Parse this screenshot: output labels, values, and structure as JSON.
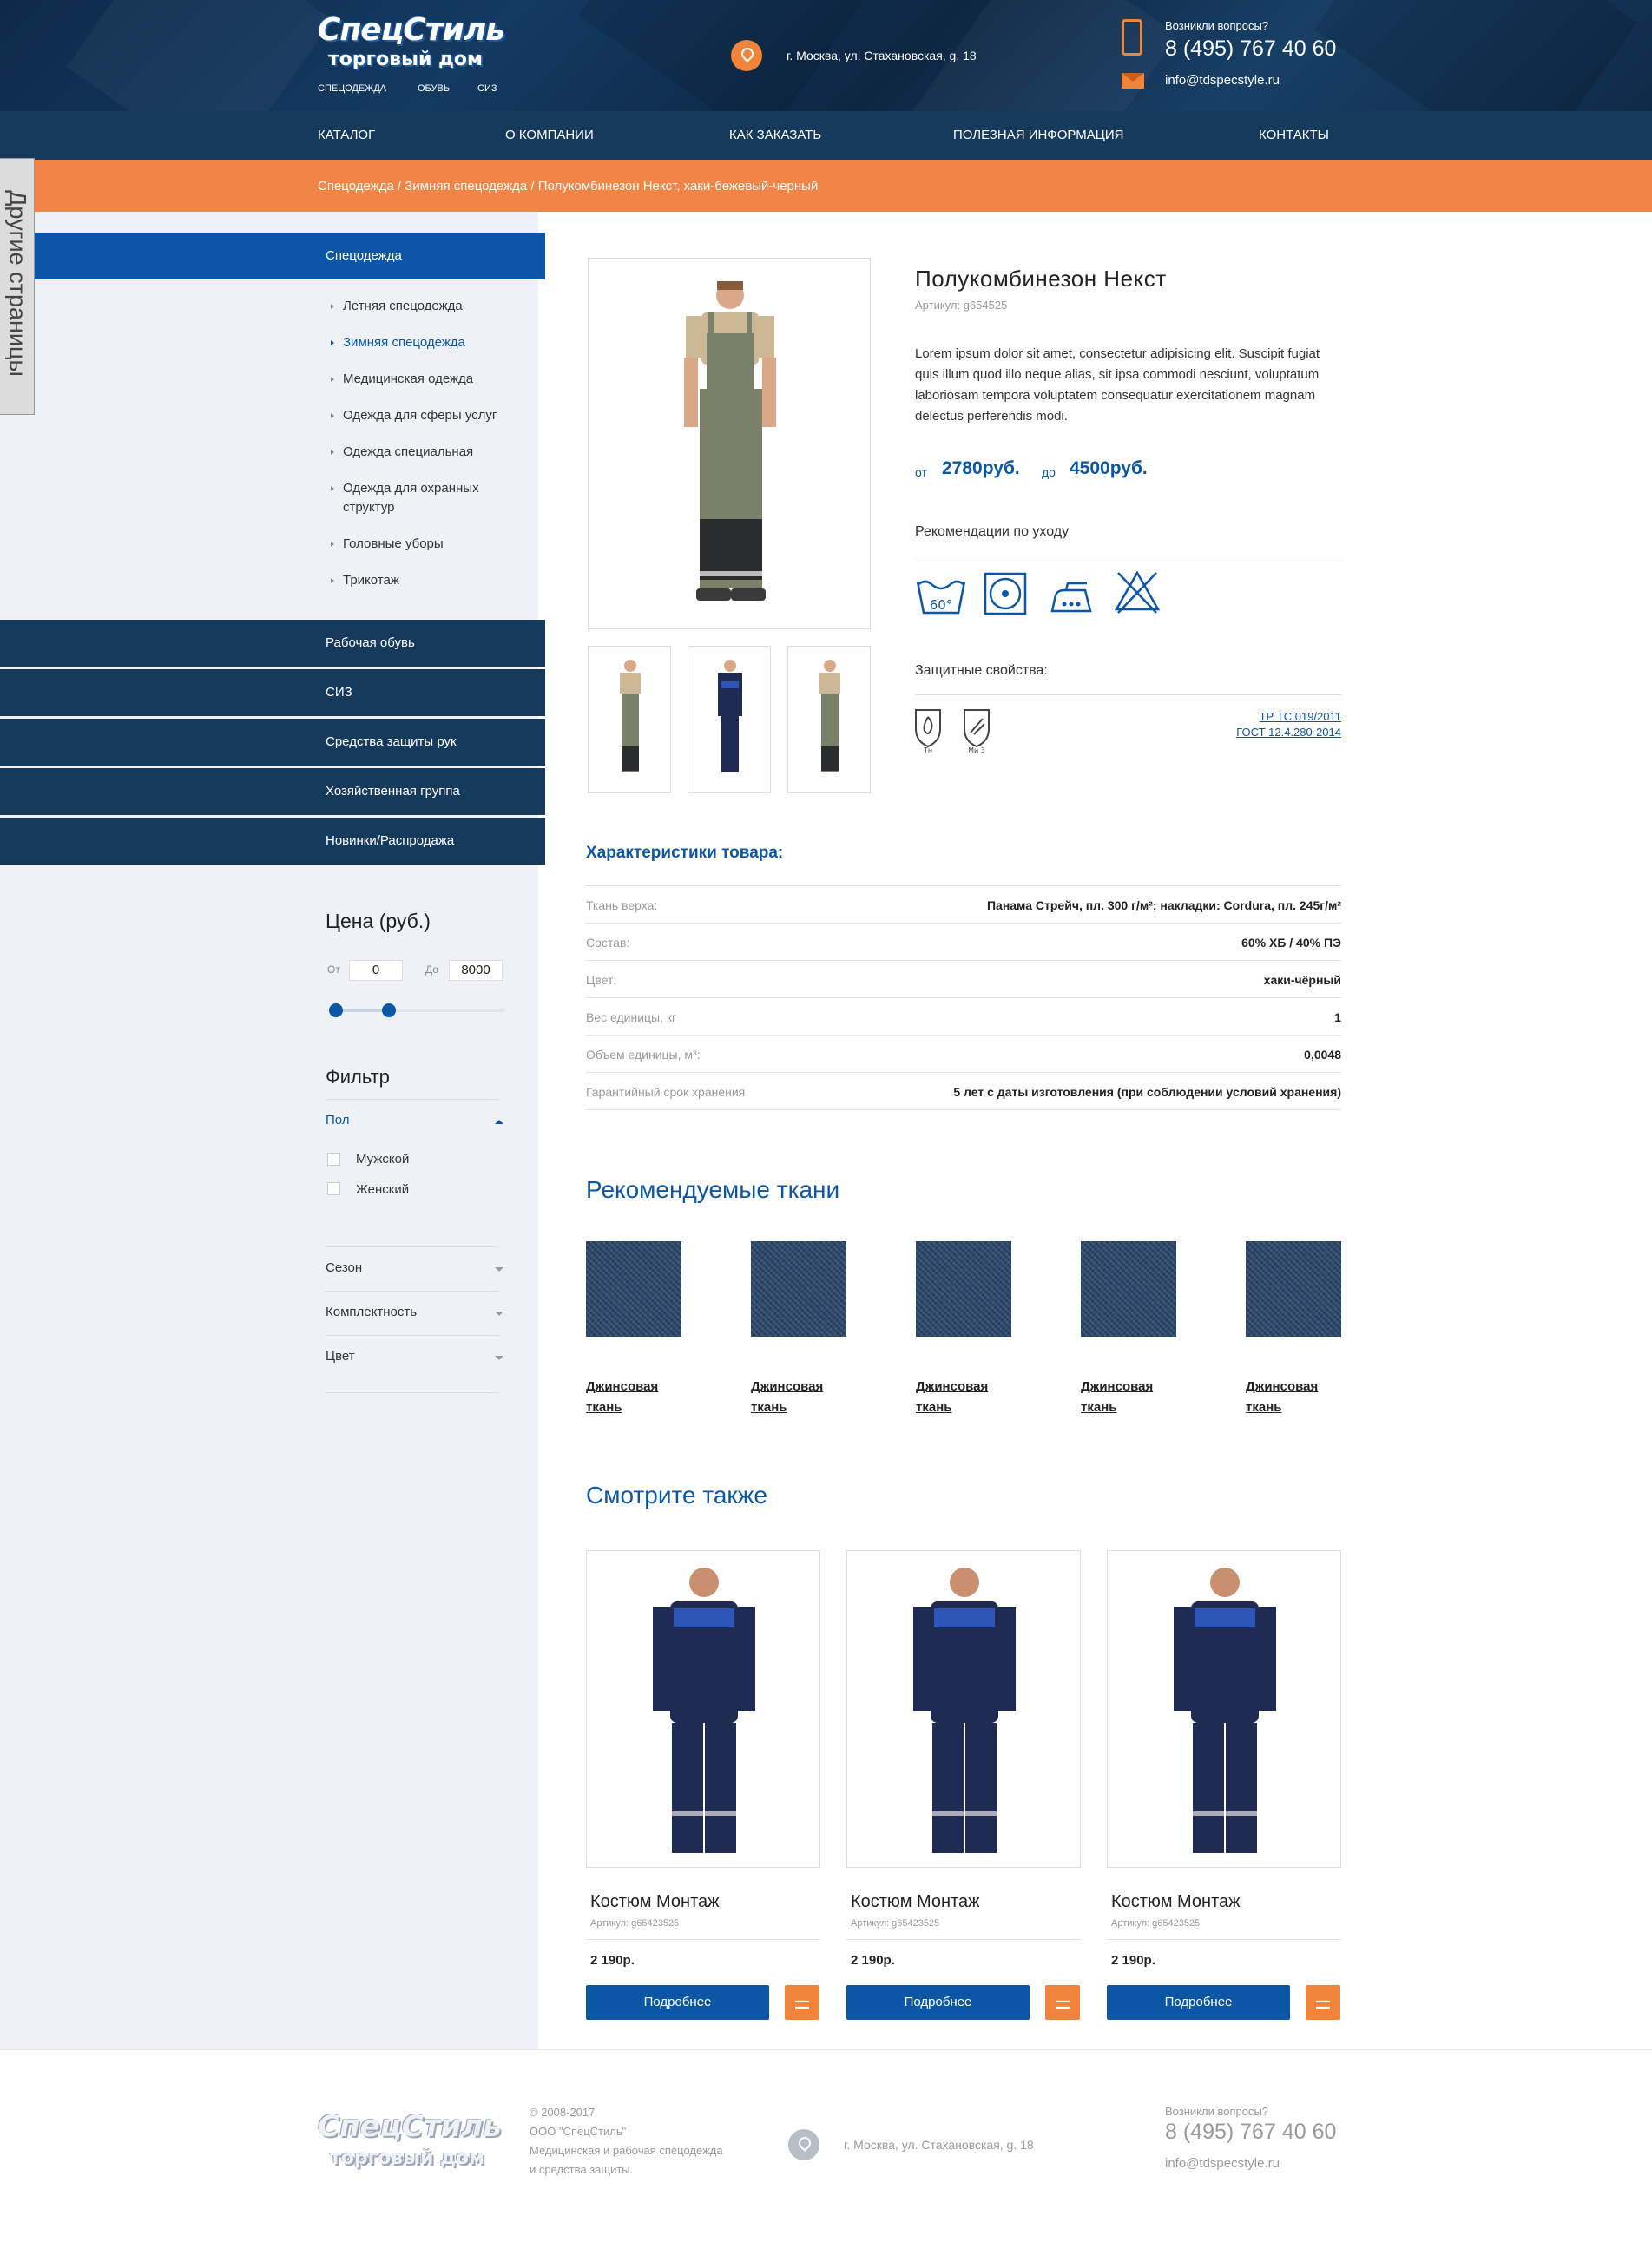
{
  "header": {
    "logo_line1": "СпецСтиль",
    "logo_line2": "торговый дом",
    "links": [
      "спецодежда",
      "обувь",
      "сиз"
    ],
    "address": "г. Москва, ул. Стахановская, g. 18",
    "question": "Возникли вопросы?",
    "phone": "8 (495) 767 40 60",
    "email": "info@tdspecstyle.ru"
  },
  "nav": [
    "КАТАЛОГ",
    "О КОМПАНИИ",
    "КАК ЗАКАЗАТЬ",
    "ПОЛЕЗНАЯ ИНФОРМАЦИЯ",
    "КОНТАКТЫ"
  ],
  "breadcrumb": "Спецодежда / Зимняя спецодежда / Полукомбинезон Некст, хаки-бежевый-черный",
  "side_tab": "Другие страницы",
  "sidebar": {
    "active_category": "Спецодежда",
    "subcategories": [
      "Летняя спецодежда",
      "Зимняя спецодежда",
      "Медицинская одежда",
      "Одежда для сферы услуг",
      "Одежда специальная",
      "Одежда для охранных структур",
      "Головные уборы",
      "Трикотаж"
    ],
    "active_sub": "Зимняя спецодежда",
    "categories": [
      "Рабочая обувь",
      "СИЗ",
      "Средства защиты рук",
      "Хозяйственная группа",
      "Новинки/Распродажа"
    ],
    "price_title": "Цена (руб.)",
    "price_from_label": "От",
    "price_from": "0",
    "price_to_label": "До",
    "price_to": "8000",
    "price_range_fraction": [
      0.0,
      0.23
    ],
    "filter_title": "Фильтр",
    "filter_gender": "Пол",
    "gender_options": [
      "Мужской",
      "Женский"
    ],
    "filter_groups": [
      "Сезон",
      "Комплектность",
      "Цвет"
    ]
  },
  "product": {
    "title": "Полукомбинезон Некст",
    "article": "Артикул: g654525",
    "description": "Lorem ipsum dolor sit amet, consectetur adipisicing elit. Suscipit fugiat quis illum quod illo neque alias, sit ipsa commodi nesciunt, voluptatum laboriosam tempora voluptatem consequatur exercitationem magnam delectus perferendis modi.",
    "price_from_label": "от",
    "price_from": "2780руб.",
    "price_to_label": "до",
    "price_to": "4500руб.",
    "care_title": "Рекомендации по уходу",
    "care_icons": [
      "wash-60-icon",
      "tumble-dry-icon",
      "iron-icon",
      "no-bleach-icon"
    ],
    "care_wash_temp": "60°",
    "protection_title": "Защитные свойства:",
    "protection_icons": [
      {
        "name": "heat-protection-icon",
        "label": "Тн"
      },
      {
        "name": "mechanical-protection-icon",
        "label": "Ми 3"
      }
    ],
    "standards": [
      "ТР ТС 019/2011",
      "ГОСТ 12.4.280-2014"
    ]
  },
  "specs": {
    "title": "Характеристики товара:",
    "rows": [
      {
        "label": "Ткань верха:",
        "value": "Панама Стрейч, пл. 300 г/м²; накладки: Cordura, пл. 245г/м²"
      },
      {
        "label": "Состав:",
        "value": "60% ХБ / 40% ПЭ"
      },
      {
        "label": "Цвет:",
        "value": "хаки-чёрный"
      },
      {
        "label": "Вес единицы, кг",
        "value": "1"
      },
      {
        "label": "Объем единицы, м³:",
        "value": "0,0048"
      },
      {
        "label": "Гарантийный срок хранения",
        "value": "5 лет с даты изготовления (при соблюдении условий хранения)"
      }
    ]
  },
  "fabrics": {
    "title": "Рекомендуемые ткани",
    "items": [
      "Джинсовая ткань",
      "Джинсовая ткань",
      "Джинсовая ткань",
      "Джинсовая ткань",
      "Джинсовая ткань"
    ]
  },
  "see_also": {
    "title": "Смотрите также",
    "items": [
      {
        "name": "Костюм Монтаж",
        "article": "Артикул: g65423525",
        "price": "2 190р.",
        "button": "Подробнее"
      },
      {
        "name": "Костюм Монтаж",
        "article": "Артикул: g65423525",
        "price": "2 190р.",
        "button": "Подробнее"
      },
      {
        "name": "Костюм Монтаж",
        "article": "Артикул: g65423525",
        "price": "2 190р.",
        "button": "Подробнее"
      }
    ]
  },
  "footer": {
    "logo_line1": "СпецСтиль",
    "logo_line2": "торговый дом",
    "copyright": "© 2008-2017",
    "company": "ООО \"СпецСтиль\"",
    "tagline1": "Медицинская и рабочая спецодежда",
    "tagline2": "и средства защиты.",
    "address": "г. Москва, ул. Стахановская, g. 18",
    "question": "Возникли вопросы?",
    "phone": "8 (495) 767 40 60",
    "email": "info@tdspecstyle.ru"
  },
  "colors": {
    "primary": "#0b56a5",
    "accent": "#f0843a",
    "dark": "#163a5c"
  }
}
